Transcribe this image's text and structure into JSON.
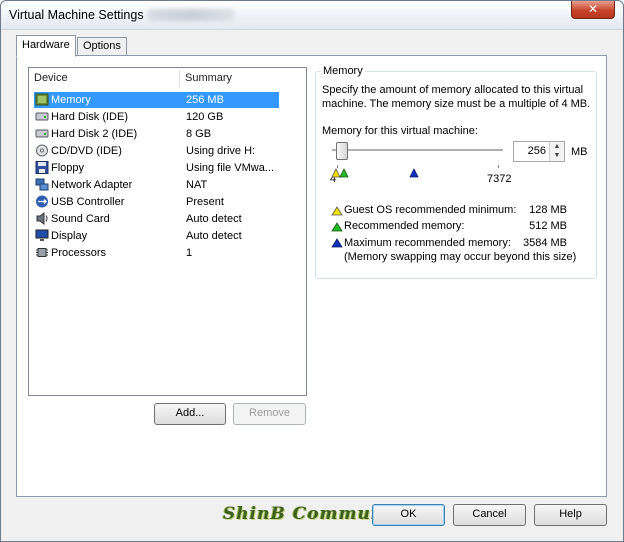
{
  "window": {
    "title": "Virtual Machine Settings",
    "close_label": "✕"
  },
  "tabs": [
    {
      "label": "Hardware",
      "active": true
    },
    {
      "label": "Options",
      "active": false
    }
  ],
  "device_list": {
    "columns": [
      "Device",
      "Summary"
    ],
    "rows": [
      {
        "device": "Memory",
        "summary": "256 MB",
        "icon": "memory-icon",
        "selected": true
      },
      {
        "device": "Hard Disk (IDE)",
        "summary": "120 GB",
        "icon": "hard-disk-icon"
      },
      {
        "device": "Hard Disk 2 (IDE)",
        "summary": "8 GB",
        "icon": "hard-disk-icon"
      },
      {
        "device": "CD/DVD (IDE)",
        "summary": "Using drive H:",
        "icon": "cd-dvd-icon"
      },
      {
        "device": "Floppy",
        "summary": "Using file VMwa...",
        "icon": "floppy-icon"
      },
      {
        "device": "Network Adapter",
        "summary": "NAT",
        "icon": "network-adapter-icon"
      },
      {
        "device": "USB Controller",
        "summary": "Present",
        "icon": "usb-icon"
      },
      {
        "device": "Sound Card",
        "summary": "Auto detect",
        "icon": "sound-card-icon"
      },
      {
        "device": "Display",
        "summary": "Auto detect",
        "icon": "display-icon"
      },
      {
        "device": "Processors",
        "summary": "1",
        "icon": "processor-icon"
      }
    ]
  },
  "list_buttons": {
    "add": "Add...",
    "remove": "Remove"
  },
  "memory": {
    "group_label": "Memory",
    "description": "Specify the amount of memory allocated to this virtual machine. The memory size must be a multiple of 4 MB.",
    "field_label": "Memory for this virtual machine:",
    "value": "256",
    "unit": "MB",
    "slider_min": "4",
    "slider_max": "7372",
    "legend": [
      {
        "label": "Guest OS recommended minimum:",
        "value": "128 MB",
        "color": "#f0e000"
      },
      {
        "label": "Recommended memory:",
        "value": "512 MB",
        "color": "#22bb22"
      },
      {
        "label": "Maximum recommended memory:",
        "value": "3584 MB",
        "color": "#1030c0"
      }
    ],
    "note": "(Memory swapping may occur beyond this size)"
  },
  "footer": {
    "watermark": "ShinB Community",
    "ok": "OK",
    "cancel": "Cancel",
    "help": "Help"
  }
}
